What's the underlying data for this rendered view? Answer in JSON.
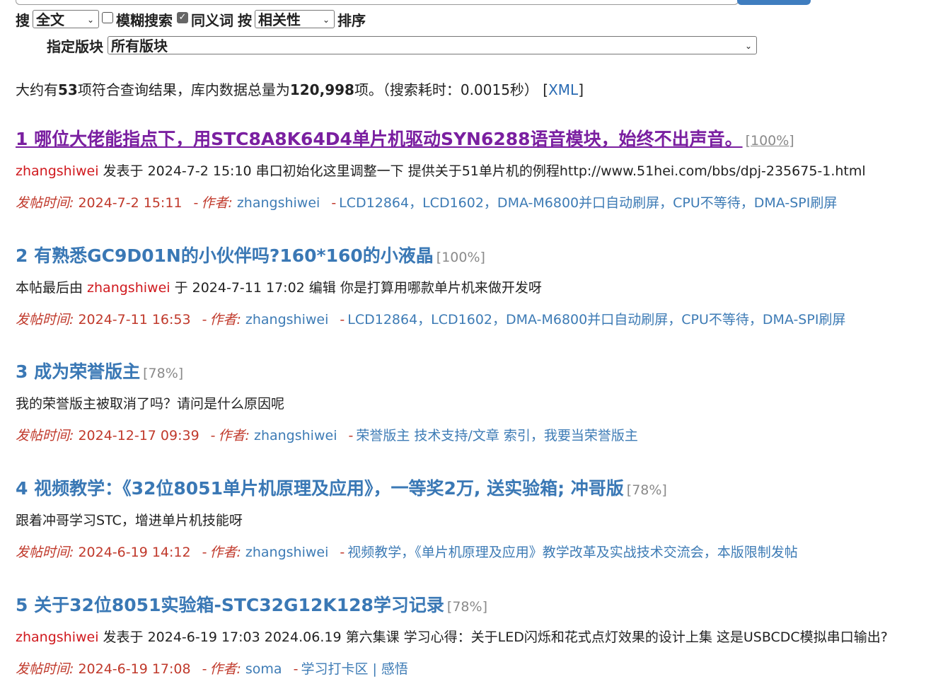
{
  "search": {
    "label_search": "搜",
    "scope_selected": "全文",
    "fuzzy_label": "模糊搜索",
    "fuzzy_checked": false,
    "synonym_label": "同义词",
    "synonym_checked": true,
    "sort_by_label": "按",
    "sort_selected": "相关性",
    "sort_suffix": "排序",
    "forum_label": "指定版块",
    "forum_selected": "所有版块"
  },
  "summary": {
    "prefix": "大约有",
    "count": "53",
    "mid": "项符合查询结果，库内数据总量为",
    "total": "120,998",
    "suffix": "项。（搜索耗时：0.0015秒）",
    "xml_open": "[",
    "xml_label": "XML",
    "xml_close": "]"
  },
  "meta_labels": {
    "time_label": "发帖时间:",
    "author_label": "作者:",
    "dash": "-"
  },
  "results": [
    {
      "title": "1 哪位大佬能指点下，用STC8A8K64D4单片机驱动SYN6288语音模块，始终不出声音。",
      "score": "[100%]",
      "snippet_author": "zhangshiwei",
      "snippet_pre": "",
      "snippet_text": " 发表于 2024-7-2 15:10 串口初始化这里调整一下 提供关于51单片机的例程http://www.51hei.com/bbs/dpj-235675-1.html",
      "time": "2024-7-2 15:11",
      "author": "zhangshiwei",
      "forum": "LCD12864，LCD1602，DMA-M6800并口自动刷屏，CPU不等待，DMA-SPI刷屏"
    },
    {
      "title": "2 有熟悉GC9D01N的小伙伴吗?160*160的小液晶",
      "score": "[100%]",
      "snippet_author": "zhangshiwei",
      "snippet_pre": "本帖最后由 ",
      "snippet_text": " 于 2024-7-11 17:02 编辑 你是打算用哪款单片机来做开发呀",
      "time": "2024-7-11 16:53",
      "author": "zhangshiwei",
      "forum": "LCD12864，LCD1602，DMA-M6800并口自动刷屏，CPU不等待，DMA-SPI刷屏"
    },
    {
      "title": "3 成为荣誉版主",
      "score": "[78%]",
      "snippet_author": "",
      "snippet_pre": "我的荣誉版主被取消了吗？请问是什么原因呢",
      "snippet_text": "",
      "time": "2024-12-17 09:39",
      "author": "zhangshiwei",
      "forum": "荣誉版主 技术支持/文章 索引，我要当荣誉版主"
    },
    {
      "title": "4 视频教学：《32位8051单片机原理及应用》，一等奖2万, 送实验箱; 冲哥版",
      "score": "[78%]",
      "snippet_author": "",
      "snippet_pre": "跟着冲哥学习STC，增进单片机技能呀",
      "snippet_text": "",
      "time": "2024-6-19 14:12",
      "author": "zhangshiwei",
      "forum": "视频教学，《单片机原理及应用》教学改革及实战技术交流会，本版限制发帖"
    },
    {
      "title": "5 关于32位8051实验箱-STC32G12K128学习记录",
      "score": "[78%]",
      "snippet_author": "zhangshiwei",
      "snippet_pre": "",
      "snippet_text": " 发表于 2024-6-19 17:03 2024.06.19 第六集课 学习心得：关于LED闪烁和花式点灯效果的设计上集 这是USBCDC模拟串口输出?",
      "time": "2024-6-19 17:08",
      "author": "soma",
      "forum": "学习打卡区 | 感悟"
    }
  ]
}
